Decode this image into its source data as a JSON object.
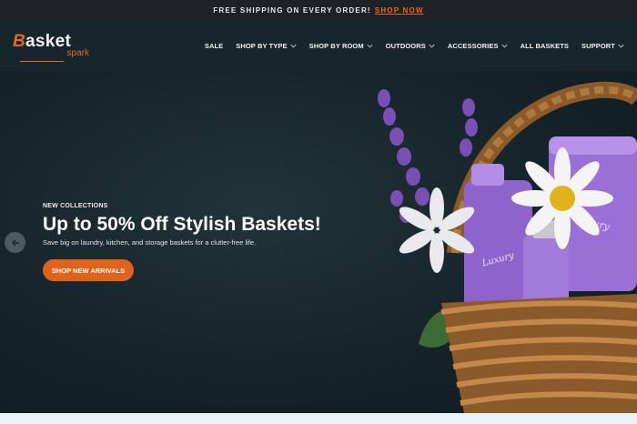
{
  "announcement": {
    "text": "FREE SHIPPING ON EVERY ORDER!",
    "link": "SHOP NOW"
  },
  "logo": {
    "name": "Basket",
    "sub": "spark"
  },
  "nav": {
    "items": [
      {
        "label": "SALE",
        "dropdown": false
      },
      {
        "label": "SHOP BY TYPE",
        "dropdown": true
      },
      {
        "label": "SHOP BY ROOM",
        "dropdown": true
      },
      {
        "label": "OUTDOORS",
        "dropdown": true
      },
      {
        "label": "ACCESSORIES",
        "dropdown": true
      },
      {
        "label": "ALL BASKETS",
        "dropdown": false
      },
      {
        "label": "SUPPORT",
        "dropdown": true
      }
    ]
  },
  "hero": {
    "kicker": "NEW COLLECTIONS",
    "headline": "Up to 50% Off Stylish Baskets!",
    "subline": "Save big on laundry, kitchen, and storage baskets for a clutter-free life.",
    "cta": "SHOP NEW ARRIVALS",
    "product_label": "Luxury Collection"
  },
  "colors": {
    "accent": "#e56a1d",
    "header_bg": "#17262c",
    "topbar_bg": "#1f2224"
  },
  "icons": {
    "prev": "arrow-left-icon",
    "chevron": "chevron-down-icon"
  }
}
